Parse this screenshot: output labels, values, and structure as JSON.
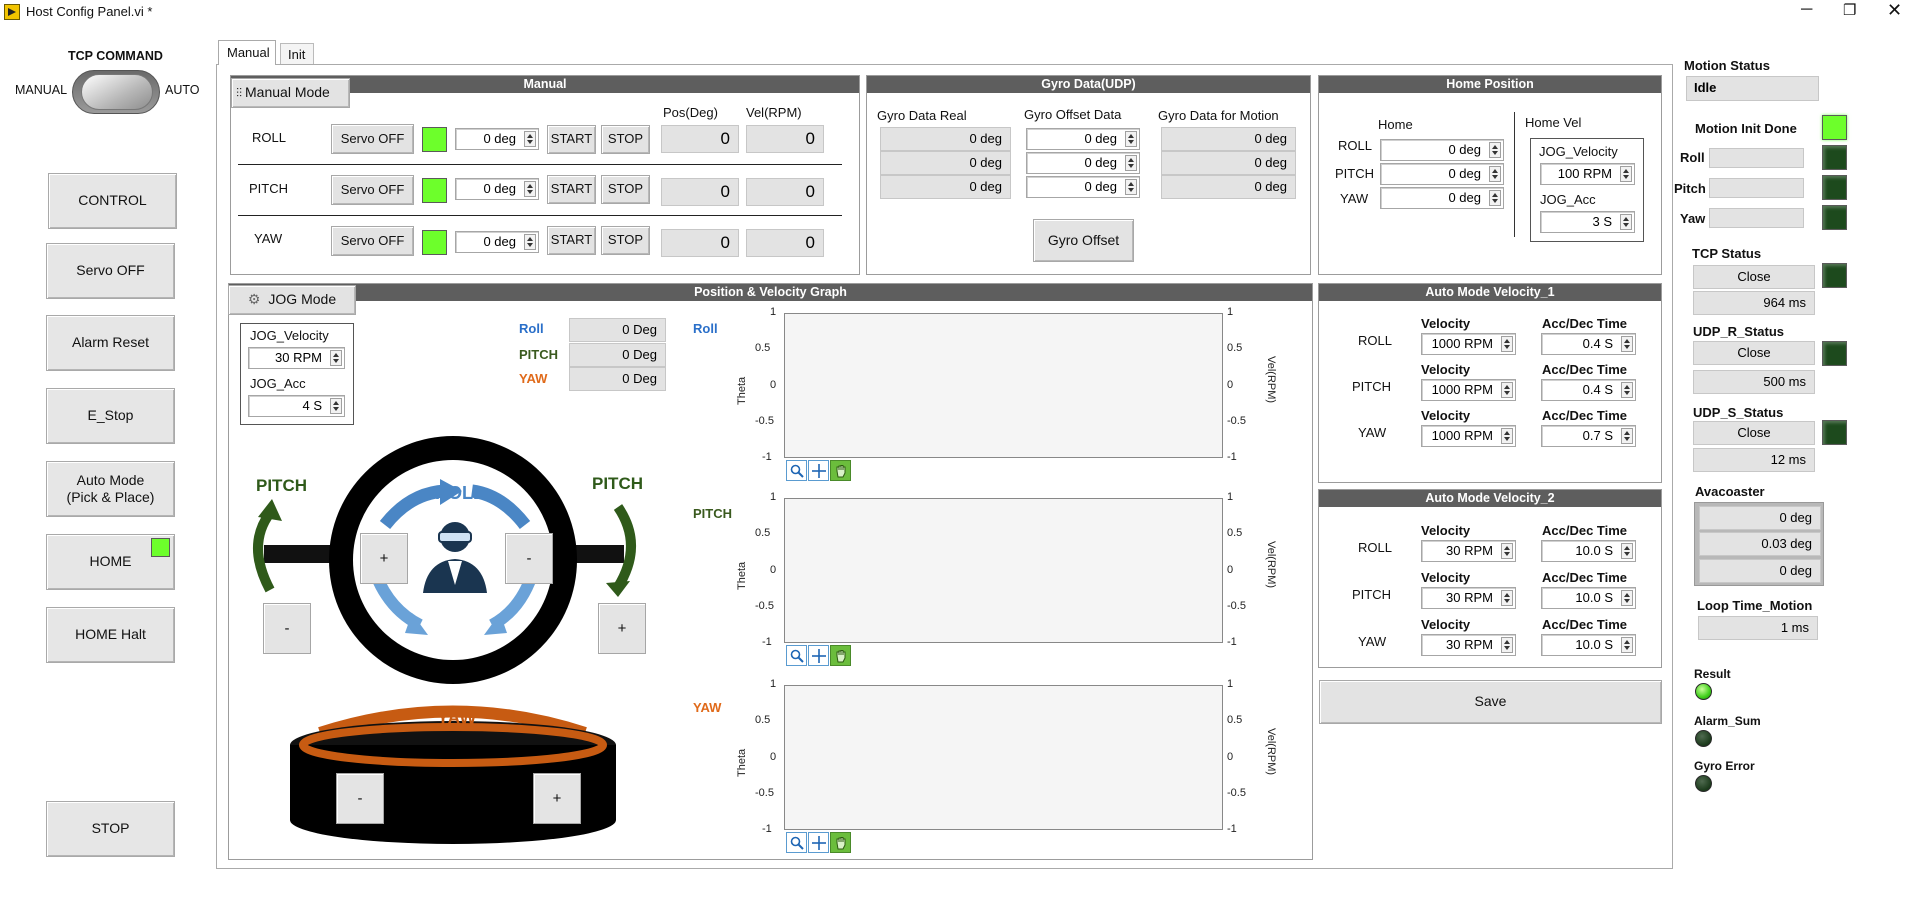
{
  "window": {
    "title": "Host Config Panel.vi *"
  },
  "tabs": [
    {
      "label": "Manual"
    },
    {
      "label": "Init"
    }
  ],
  "tcp_command": {
    "title": "TCP COMMAND",
    "left": "MANUAL",
    "right": "AUTO"
  },
  "left_buttons": {
    "control": "CONTROL",
    "servo_off": "Servo OFF",
    "alarm_reset": "Alarm Reset",
    "e_stop": "E_Stop",
    "auto_mode": "Auto Mode\n(Pick & Place)",
    "home": "HOME",
    "home_halt": "HOME Halt",
    "stop": "STOP"
  },
  "manual": {
    "header": "Manual",
    "mode_button": "Manual Mode",
    "pos_label": "Pos(Deg)",
    "vel_label": "Vel(RPM)",
    "rows": [
      {
        "axis": "ROLL",
        "servo": "Servo OFF",
        "deg": "0 deg",
        "start": "START",
        "stop": "STOP",
        "pos": "0",
        "vel": "0"
      },
      {
        "axis": "PITCH",
        "servo": "Servo OFF",
        "deg": "0 deg",
        "start": "START",
        "stop": "STOP",
        "pos": "0",
        "vel": "0"
      },
      {
        "axis": "YAW",
        "servo": "Servo OFF",
        "deg": "0 deg",
        "start": "START",
        "stop": "STOP",
        "pos": "0",
        "vel": "0"
      }
    ]
  },
  "gyro": {
    "header": "Gyro Data(UDP)",
    "col_real": "Gyro Data Real",
    "col_offset": "Gyro Offset Data",
    "col_motion": "Gyro Data for Motion",
    "real": [
      "0 deg",
      "0 deg",
      "0 deg"
    ],
    "offset": [
      "0 deg",
      "0 deg",
      "0 deg"
    ],
    "motion": [
      "0 deg",
      "0 deg",
      "0 deg"
    ],
    "button": "Gyro Offset"
  },
  "home_position": {
    "header": "Home Position",
    "home_label": "Home",
    "home_vel_label": "Home Vel",
    "rows": [
      {
        "axis": "ROLL",
        "value": "0 deg"
      },
      {
        "axis": "PITCH",
        "value": "0 deg"
      },
      {
        "axis": "YAW",
        "value": "0 deg"
      }
    ],
    "jog_velocity_label": "JOG_Velocity",
    "jog_velocity": "100 RPM",
    "jog_acc_label": "JOG_Acc",
    "jog_acc": "3 S"
  },
  "jog": {
    "mode_button": "JOG Mode",
    "velocity_label": "JOG_Velocity",
    "velocity": "30 RPM",
    "acc_label": "JOG_Acc",
    "acc": "4 S",
    "readouts": [
      {
        "name": "Roll",
        "value": "0 Deg",
        "color": "#2a6fc9"
      },
      {
        "name": "PITCH",
        "value": "0 Deg",
        "color": "#3a5a1e"
      },
      {
        "name": "YAW",
        "value": "0 Deg",
        "color": "#e06a1a"
      }
    ],
    "diagram": {
      "pitch_left": "PITCH",
      "pitch_right": "PITCH",
      "roll": "ROLL",
      "yaw": "YAW",
      "plus": "+",
      "minus": "-"
    }
  },
  "graph": {
    "header": "Position & Velocity Graph",
    "left_axis": "Theta",
    "right_axis": "Vel(RPM)",
    "ticks": [
      "1",
      "0.5",
      "0",
      "-0.5",
      "-1"
    ],
    "plots": [
      {
        "name": "Roll",
        "color": "#2a6fc9"
      },
      {
        "name": "PITCH",
        "color": "#3a5a1e"
      },
      {
        "name": "YAW",
        "color": "#e06a1a"
      }
    ]
  },
  "auto_vel_1": {
    "header": "Auto Mode Velocity_1",
    "velocity_label": "Velocity",
    "acc_label": "Acc/Dec Time",
    "rows": [
      {
        "axis": "ROLL",
        "vel": "1000 RPM",
        "acc": "0.4 S"
      },
      {
        "axis": "PITCH",
        "vel": "1000 RPM",
        "acc": "0.4 S"
      },
      {
        "axis": "YAW",
        "vel": "1000 RPM",
        "acc": "0.7 S"
      }
    ]
  },
  "auto_vel_2": {
    "header": "Auto Mode Velocity_2",
    "velocity_label": "Velocity",
    "acc_label": "Acc/Dec Time",
    "rows": [
      {
        "axis": "ROLL",
        "vel": "30 RPM",
        "acc": "10.0 S"
      },
      {
        "axis": "PITCH",
        "vel": "30 RPM",
        "acc": "10.0 S"
      },
      {
        "axis": "YAW",
        "vel": "30 RPM",
        "acc": "10.0 S"
      }
    ]
  },
  "save_button": "Save",
  "status": {
    "motion_status_label": "Motion Status",
    "motion_status": "Idle",
    "motion_init_done": "Motion Init Done",
    "init_axes": [
      "Roll",
      "Pitch",
      "Yaw"
    ],
    "tcp_status_label": "TCP Status",
    "tcp_status": "Close",
    "tcp_ms": "964 ms",
    "udp_r_label": "UDP_R_Status",
    "udp_r": "Close",
    "udp_r_ms": "500 ms",
    "udp_s_label": "UDP_S_Status",
    "udp_s": "Close",
    "udp_s_ms": "12 ms",
    "avacoaster_label": "Avacoaster",
    "avacoaster": [
      "0 deg",
      "0.03 deg",
      "0 deg"
    ],
    "loop_time_label": "Loop Time_Motion",
    "loop_time": "1 ms",
    "result": "Result",
    "alarm_sum": "Alarm_Sum",
    "gyro_error": "Gyro Error"
  },
  "colors": {
    "led_on": "#6dff2b",
    "led_dark": "#1d4a1d",
    "header": "#5e5e5e",
    "roll_blue": "#2a6fc9",
    "pitch_green": "#3a5a1e",
    "yaw_orange": "#e06a1a"
  }
}
